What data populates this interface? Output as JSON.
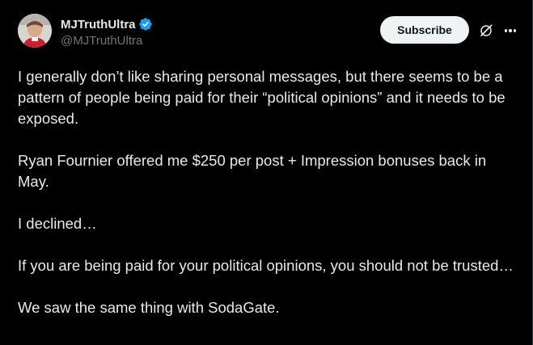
{
  "post": {
    "author": {
      "display_name": "MJTruthUltra",
      "handle": "@MJTruthUltra",
      "verified": true,
      "verified_icon": "verified-badge-icon"
    },
    "actions": {
      "subscribe_label": "Subscribe",
      "grok_icon": "grok-icon",
      "more_icon": "more-icon"
    },
    "paragraphs": [
      "I generally don’t like sharing personal messages, but there seems to be a pattern of people being paid for their “political opinions” and it needs to be exposed.",
      "Ryan Fournier offered me $250 per post + Impression bonuses back in May.",
      "I declined…",
      "If you are being paid for your political opinions, you should not be trusted…",
      "We saw the same thing with SodaGate."
    ]
  },
  "colors": {
    "background": "#000000",
    "text": "#e7e9ea",
    "secondary_text": "#71767b",
    "verified": "#1d9bf0",
    "button_bg": "#eff3f4",
    "button_text": "#0f1419"
  }
}
